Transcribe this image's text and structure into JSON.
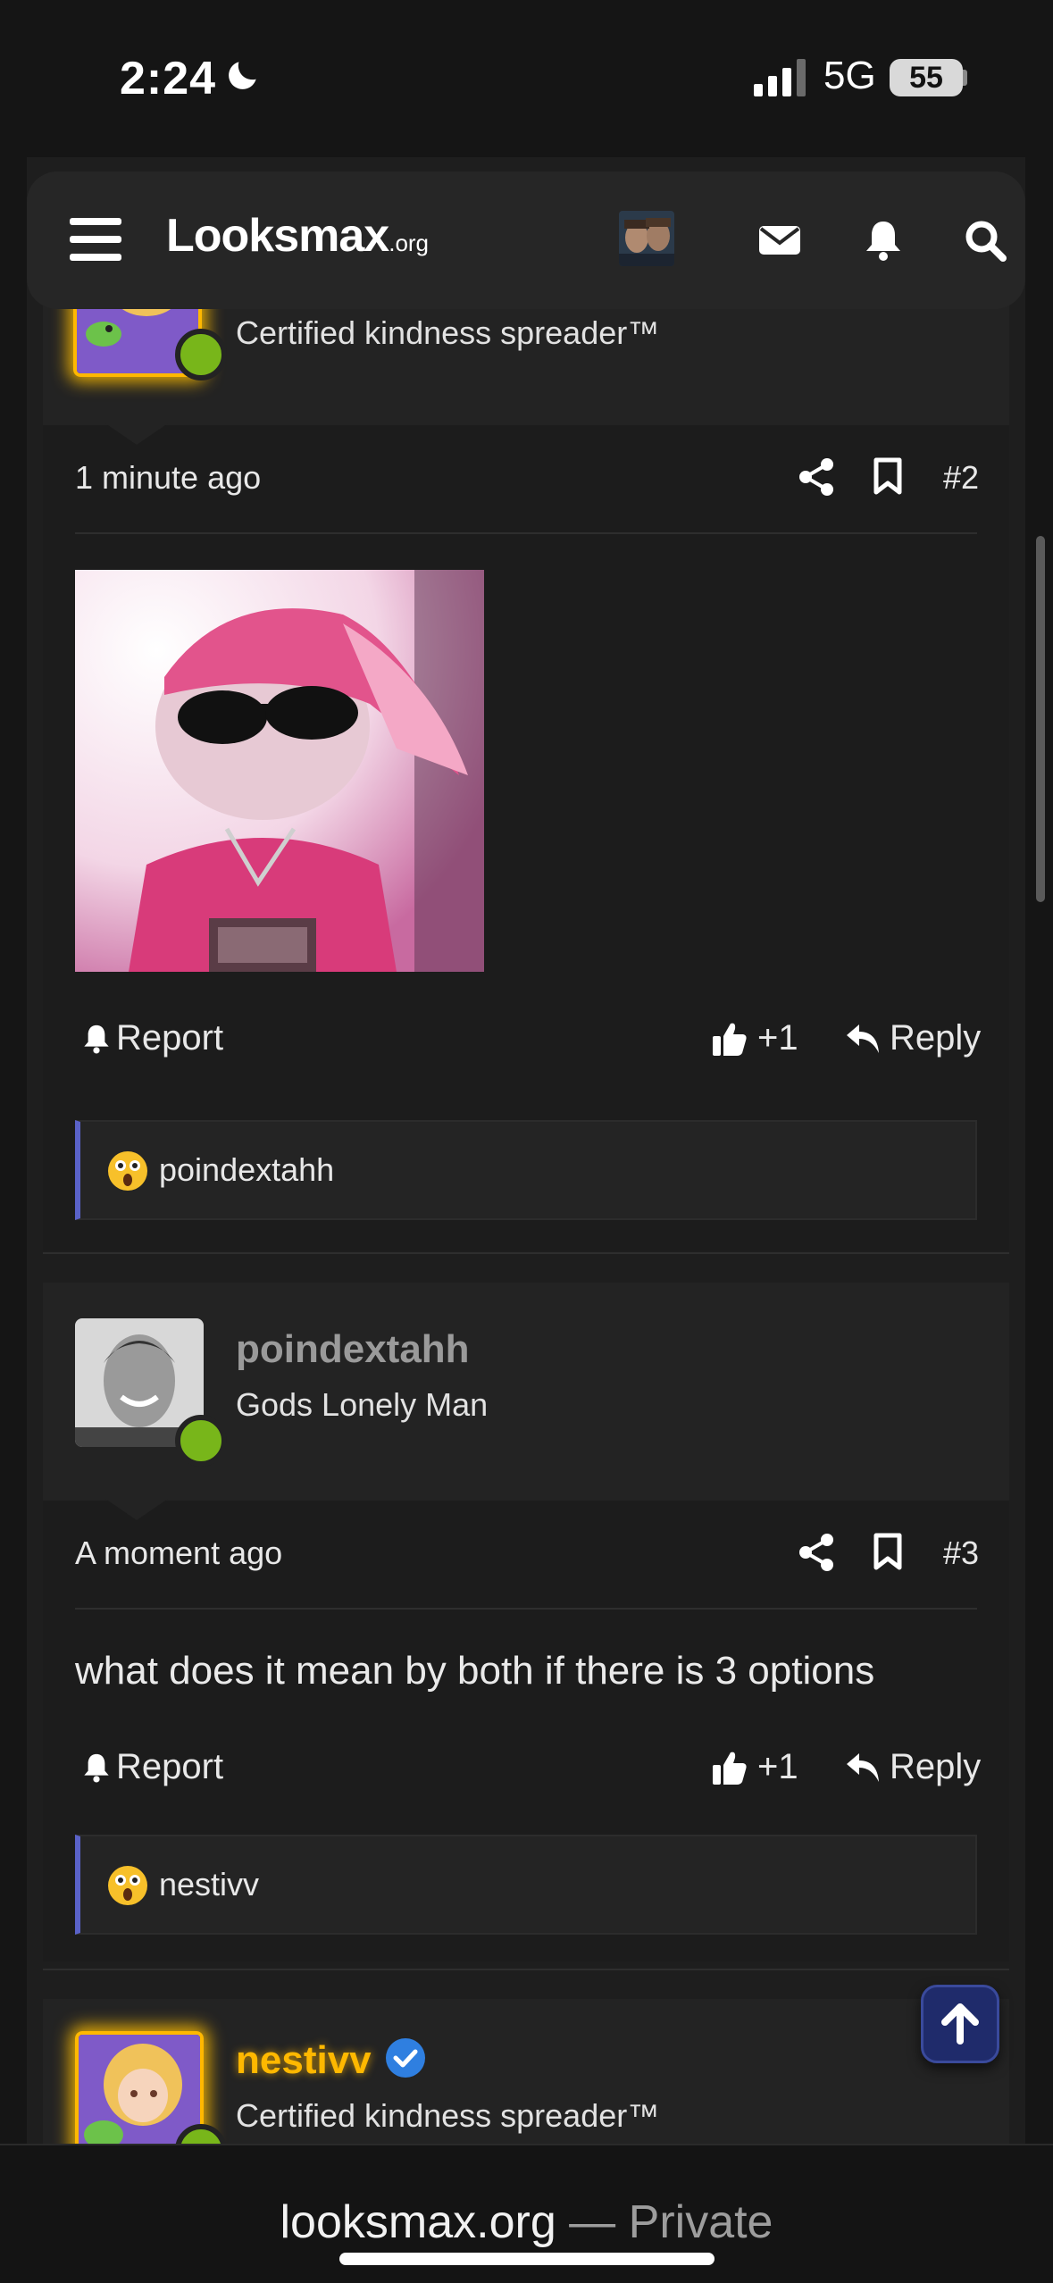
{
  "status_bar": {
    "time": "2:24",
    "network": "5G",
    "battery": "55"
  },
  "nav": {
    "logo_main": "Looksmax",
    "logo_suffix": ".org"
  },
  "posts": [
    {
      "user_title": "Certified kindness spreader™",
      "time": "1 minute ago",
      "number": "#2",
      "image_alt": "cat wearing pink cap, sunglasses and chain",
      "report_label": "Report",
      "like_count": "+1",
      "reply_label": "Reply",
      "reaction_user": "poindextahh"
    },
    {
      "username": "poindextahh",
      "user_title": "Gods Lonely Man",
      "time": "A moment ago",
      "number": "#3",
      "body": "what does it mean by both if there is 3 options",
      "report_label": "Report",
      "like_count": "+1",
      "reply_label": "Reply",
      "reaction_user": "nestivv"
    },
    {
      "username": "nestivv",
      "user_title": "Certified kindness spreader™"
    }
  ],
  "bottom_bar": {
    "domain": "looksmax.org",
    "separator": " — ",
    "mode": "Private"
  },
  "colors": {
    "accent": "#5a62c8",
    "online": "#78b61a",
    "gold_name": "#ffb800",
    "verified": "#2f7fe0"
  }
}
